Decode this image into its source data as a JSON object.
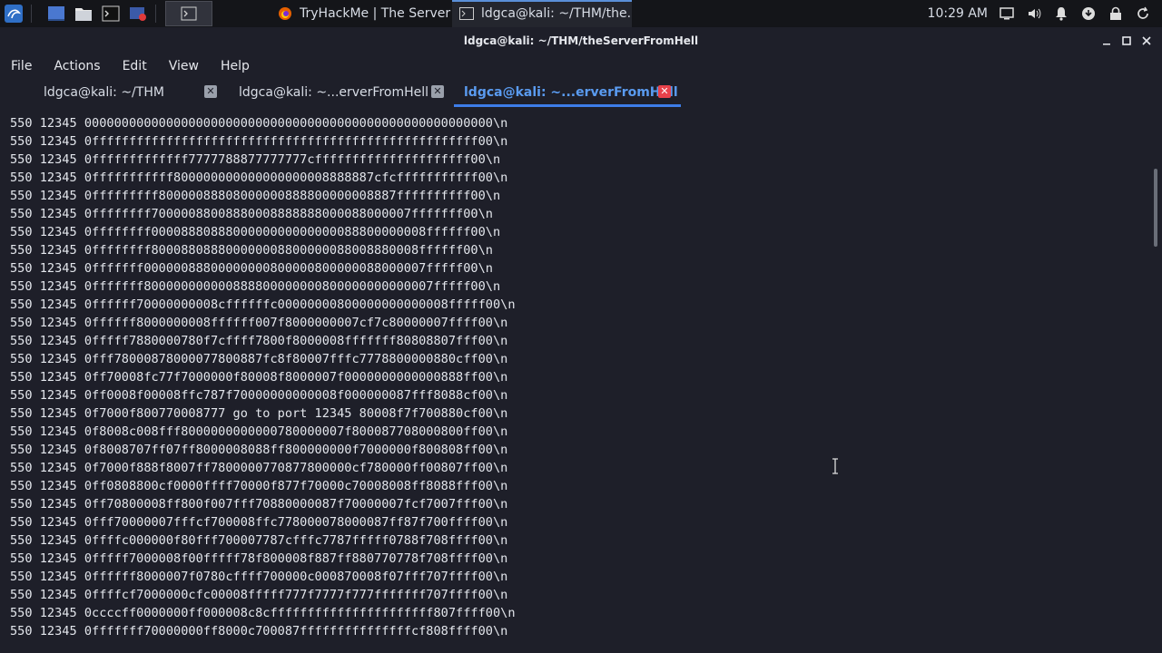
{
  "taskbar": {
    "tasks": [
      {
        "label": "TryHackMe | The Server ...",
        "icon": "firefox-icon"
      },
      {
        "label": "ldgca@kali: ~/THM/the...",
        "icon": "terminal-icon"
      }
    ],
    "clock": "10:29 AM"
  },
  "window": {
    "title": "ldgca@kali: ~/THM/theServerFromHell"
  },
  "menu": [
    "File",
    "Actions",
    "Edit",
    "View",
    "Help"
  ],
  "tabs": [
    {
      "label": "ldgca@kali: ~/THM",
      "active": false
    },
    {
      "label": "ldgca@kali: ~...erverFromHell",
      "active": false
    },
    {
      "label": "ldgca@kali: ~...erverFromHell",
      "active": true
    }
  ],
  "terminal": {
    "lines": [
      "550 12345 0000000000000000000000000000000000000000000000000000000\\n",
      "550 12345 0ffffffffffffffffffffffffffffffffffffffffffffffffffff00\\n",
      "550 12345 0fffffffffffff7777788877777777cfffffffffffffffffffff00\\n",
      "550 12345 0fffffffffff800000000000000000008888887cfcfffffffffff00\\n",
      "550 12345 0fffffffff80000088808000000888800000008887ffffffffff00\\n",
      "550 12345 0ffffffff70000088008880008888888000088000007fffffff00\\n",
      "550 12345 0ffffffff0000888088800000000000000088800000008ffffff00\\n",
      "550 12345 0ffffffff800088088800000008800000088008880008ffffff00\\n",
      "550 12345 0fffffff00000088800000000800000800000088000007fffff00\\n",
      "550 12345 0fffffff800000000000888800000000800000000000007fffff00\\n",
      "550 12345 0ffffff70000000008cffffffc00000000800000000000008fffff00\\n",
      "550 12345 0ffffff8000000008ffffff007f8000000007cf7c80000007ffff00\\n",
      "550 12345 0fffff7880000780f7cffff7800f8000008fffffff80808807fff00\\n",
      "550 12345 0fff78000878000077800887fc8f80007fffc7778800000880cff00\\n",
      "550 12345 0ff70008fc77f7000000f80008f8000007f0000000000000888ff00\\n",
      "550 12345 0ff0008f00008ffc787f70000000000008f000000087fff8088cf00\\n",
      "550 12345 0f7000f800770008777 go to port 12345 80008f7f700880cf00\\n",
      "550 12345 0f8008c008fff8000000000000780000007f800087708000800ff00\\n",
      "550 12345 0f8008707ff07ff8000008088ff800000000f7000000f800808ff00\\n",
      "550 12345 0f7000f888f8007ff7800000770877800000cf780000ff00807ff00\\n",
      "550 12345 0ff0808800cf0000ffff70000f877f70000c70008008ff8088fff00\\n",
      "550 12345 0ff70800008ff800f007fff70880000087f70000007fcf7007fff00\\n",
      "550 12345 0fff70000007fffcf700008ffc778000078000087ff87f700ffff00\\n",
      "550 12345 0ffffc000000f80fff700007787cfffc7787fffff0788f708ffff00\\n",
      "550 12345 0fffff7000008f00fffff78f800008f887ff880770778f708ffff00\\n",
      "550 12345 0ffffff8000007f0780cffff700000c000870008f07fff707ffff00\\n",
      "550 12345 0ffffcf7000000cfc00008fffff777f7777f777fffffff707ffff00\\n",
      "550 12345 0ccccff0000000ff000008c8cffffffffffffffffffffff807ffff00\\n",
      "550 12345 0fffffff70000000ff8000c700087fffffffffffffffcf808ffff00\\n"
    ]
  }
}
